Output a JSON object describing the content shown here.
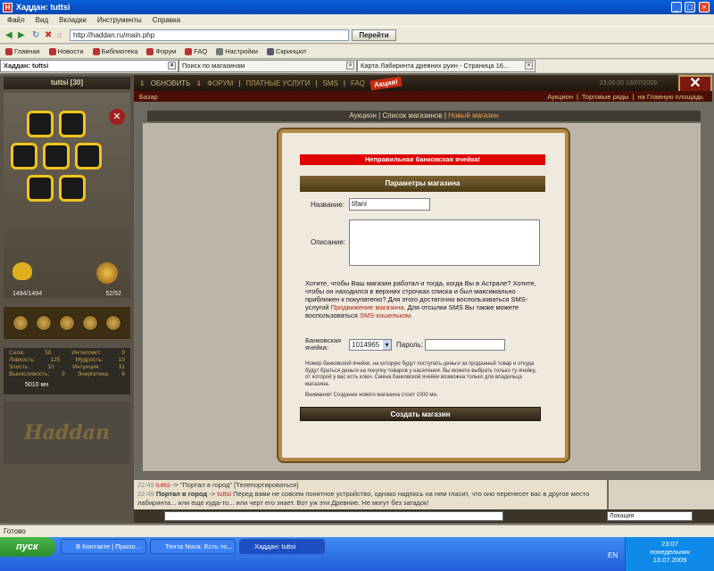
{
  "window": {
    "title": "Хаддан: tuttsi"
  },
  "menu": [
    "Файл",
    "Вид",
    "Вкладки",
    "Инструменты",
    "Справка"
  ],
  "address": {
    "url": "http://haddan.ru/main.php",
    "go_label": "Перейти"
  },
  "bookmarks": [
    "Главная",
    "Новости",
    "Библиотека",
    "Форум",
    "FAQ",
    "Настройки",
    "Скриншот"
  ],
  "tabs": [
    "Хаддан: tuttsi",
    "Поиск по магазинам",
    "Карта Лабиринта древних руин - Страница 16..."
  ],
  "topnav": {
    "refresh": "ОБНОВИТЬ",
    "links": [
      "ФОРУМ",
      "ПЛАТНЫЕ УСЛУГИ",
      "SMS",
      "FAQ"
    ],
    "promo": "Акция!",
    "time": "23:06:20   13/07/2009"
  },
  "bazaar": {
    "left": "Базар",
    "right": [
      "Аукцион",
      "Торговые ряды",
      "на Главную площадь"
    ]
  },
  "character": {
    "name": "tuttsi [30]",
    "hp": "1494/1494",
    "mp": "52/52",
    "money": "5010 мн"
  },
  "stats": [
    {
      "k": "Сила:",
      "v": "50",
      "k2": "Интеллект:",
      "v2": "9"
    },
    {
      "k": "Ловкость:",
      "v": "125",
      "k2": "Мудрость:",
      "v2": "10"
    },
    {
      "k": "Злость:",
      "v": "10",
      "k2": "Интуиция:",
      "v2": "31"
    },
    {
      "k": "Выносливость:",
      "v": "9",
      "k2": "Энергетика:",
      "v2": "6"
    }
  ],
  "logo": "Haddan",
  "subnav": {
    "a": "Аукцион",
    "b": "Список магазинов",
    "c": "Новый магазин"
  },
  "form": {
    "error": "Неправильная банковская ячейка!",
    "header": "Параметры магазина",
    "name_label": "Название:",
    "name_value": "tifani",
    "desc_label": "Описание:",
    "info1": "Хотите, чтобы Ваш магазин работал и тогда, когда Вы в Астрале? Хотите, чтобы он находился в верхних строчках списка и был максимально приближен к покупателю? Для этого достаточно воспользоваться SMS-услугой ",
    "info_link1": "Продвижение магазина",
    "info2": ". Для отсылки SMS Вы также можете воспользоваться ",
    "info_link2": "SMS-кошельком",
    "info3": ".",
    "bank_label": "Банковская ячейка:",
    "bank_value": "1014965",
    "pass_label": "Пароль:",
    "note": "Номер банковской ячейки, на которую будут поступать деньги за проданный товар и откуда будут браться деньги на покупку товаров у населения. Вы можете выбрать только ту ячейку, от которой у вас есть ключ. Смена банковской ячейки возможна только для владельца магазина.",
    "warning": "Внимание! Создание нового магазина стоит 1000 мн.",
    "create": "Создать магазин"
  },
  "chat": {
    "t1": "22:49",
    "n1": "tuttsi",
    "m1": " -> \"Портал в город\" [Телепортироваться]",
    "t2": "22:49",
    "b2": "Портал в город",
    "n2": "tuttsi",
    "m2": " Перед вами не совсем понятное устройство, однако надпись на нем гласит, что оно перенесет вас в другое место лабиринта... или еще куда-то... или черт его знает. Вот уж эти Древние. Не могут без загадок!",
    "channel": "Локация"
  },
  "status": "Готово",
  "taskbar": {
    "start": "пуск",
    "tasks": [
      "В Контакте | Прило...",
      "Тента Nova: Есть то...",
      "Хаддан: tuttsi"
    ],
    "lang": "EN",
    "time": "23:07",
    "day": "понедельник",
    "date": "13.07.2009"
  }
}
